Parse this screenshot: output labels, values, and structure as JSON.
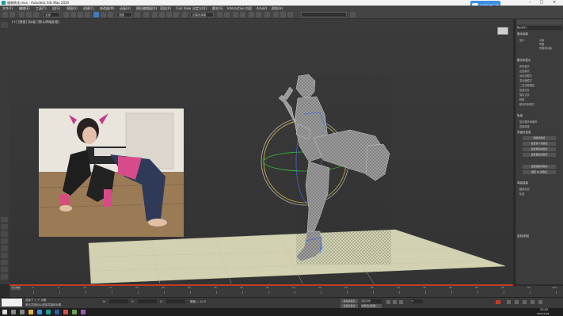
{
  "window": {
    "title": "服装转化.max - Autodesk 3ds Max 2020"
  },
  "menubar": {
    "items": [
      "文件(F)",
      "编辑(E)",
      "工具(T)",
      "组(G)",
      "视图(V)",
      "创建(C)",
      "修改器(M)",
      "动画(A)",
      "图形编辑器(D)",
      "渲染(R)",
      "Civil View",
      "自定义(U)",
      "脚本(S)",
      "Interactive",
      "内容",
      "Arnold",
      "帮助(H)"
    ]
  },
  "cloud_badge": {
    "label": "新建百度云网"
  },
  "toolbar": {
    "selection_filter": "全部",
    "view_dropdown": "视图",
    "named_set": "创建选择集"
  },
  "viewport": {
    "label": "[+] [透视] [标准] [默认明暗处理]"
  },
  "command_panel": {
    "object_name": "Bip001",
    "rollout_basic": "基本参数",
    "rollout_modes": "模式和显示",
    "rollout_bend": "弯曲链接",
    "rollout_track": "轨迹",
    "rollout_keys": "关键点信息",
    "rollout_copy": "复制/粘贴",
    "items": [
      "体形模式",
      "足迹模式",
      "运动流模式",
      "混合器模式",
      "二足动物播放",
      "加载文件",
      "保存文件",
      "转换",
      "移动所有模式"
    ],
    "buttons": [
      "创建关键点",
      "设置多个关键点",
      "设置滑动关键点",
      "设置自由关键点",
      "设置踩踏关键点",
      "锁定 IK 关键点"
    ],
    "options": [
      "显示",
      "对象",
      "骨骼",
      "骨骼和对象",
      "显示脚步和编号",
      "扭曲链接",
      "腿部状态",
      "轨迹"
    ]
  },
  "timeline": {
    "frame_readout": "0 / 100",
    "ticks": [
      "0",
      "5",
      "10",
      "15",
      "20",
      "25",
      "30",
      "35",
      "40",
      "45",
      "50",
      "55",
      "60",
      "65",
      "70",
      "75",
      "80",
      "85",
      "90",
      "95",
      "100"
    ]
  },
  "statusbar": {
    "selected": "选择了 1 个 对象",
    "prompt": "单击并拖动以选择并旋转对象",
    "x": "X:",
    "y": "Y:",
    "z": "Z:",
    "grid": "栅格 = 10.0",
    "autokey": "自动关键点",
    "setkey": "设置关键点",
    "selected_label": "选定对象",
    "key_filters": "关键点过滤器...",
    "frame": "0"
  },
  "taskbar": {
    "clock": "20:42",
    "date": "2021/1/28"
  },
  "colors": {
    "accent_blue": "#3f7bc4",
    "viewport_red_border": "#c23b22",
    "ground_plane": "#d2d2b2",
    "mesh": "#c8c8c8"
  }
}
